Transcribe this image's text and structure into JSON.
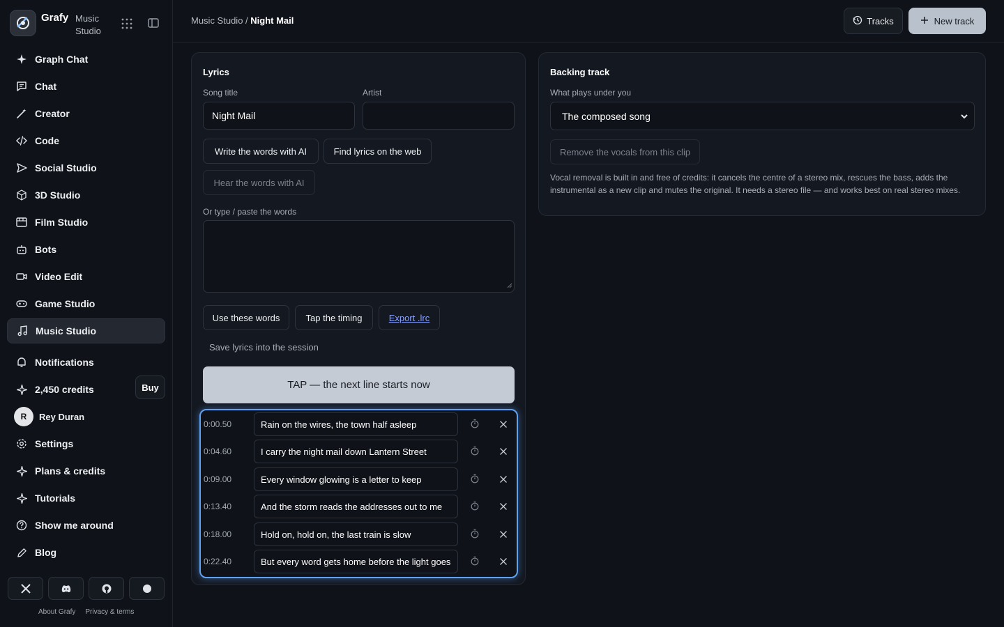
{
  "brand": {
    "name": "Grafy",
    "sub": "Music Studio"
  },
  "nav": [
    {
      "label": "Graph Chat",
      "icon": "sparkle-icon",
      "active": false
    },
    {
      "label": "Chat",
      "icon": "chat-icon",
      "active": false
    },
    {
      "label": "Creator",
      "icon": "magic-wand-icon",
      "active": false
    },
    {
      "label": "Code",
      "icon": "code-icon",
      "active": false
    },
    {
      "label": "Social Studio",
      "icon": "send-icon",
      "active": false
    },
    {
      "label": "3D Studio",
      "icon": "cube-icon",
      "active": false
    },
    {
      "label": "Film Studio",
      "icon": "film-icon",
      "active": false
    },
    {
      "label": "Bots",
      "icon": "bot-icon",
      "active": false
    },
    {
      "label": "Video Edit",
      "icon": "video-icon",
      "active": false
    },
    {
      "label": "Game Studio",
      "icon": "gamepad-icon",
      "active": false
    },
    {
      "label": "Music Studio",
      "icon": "music-icon",
      "active": true
    }
  ],
  "account": {
    "notifications": "Notifications",
    "credits": "2,450 credits",
    "buy": "Buy",
    "user_initial": "R",
    "user_name": "Rey Duran",
    "settings": "Settings",
    "plans": "Plans & credits",
    "tutorials": "Tutorials",
    "tour": "Show me around",
    "blog": "Blog"
  },
  "footer": {
    "about": "About Grafy",
    "privacy": "Privacy & terms"
  },
  "header": {
    "crumb_root": "Music Studio",
    "crumb_sep": " / ",
    "crumb_current": "Night Mail",
    "tracks_label": "Tracks",
    "new_track_label": "New track"
  },
  "lyrics": {
    "title": "Lyrics",
    "song_title_label": "Song title",
    "song_title_value": "Night Mail",
    "artist_label": "Artist",
    "artist_value": "",
    "write_ai": "Write the words with AI",
    "find_web": "Find lyrics on the web",
    "hear_ai": "Hear the words with AI",
    "paste_label": "Or type / paste the words",
    "use_words": "Use these words",
    "tap_timing": "Tap the timing",
    "export_lrc": "Export .lrc",
    "save_note": "Save lyrics into the session",
    "tap_button": "TAP — the next line starts now",
    "lines": [
      {
        "time": "0:00.50",
        "text": "Rain on the wires, the town half asleep"
      },
      {
        "time": "0:04.60",
        "text": "I carry the night mail down Lantern Street"
      },
      {
        "time": "0:09.00",
        "text": "Every window glowing is a letter to keep"
      },
      {
        "time": "0:13.40",
        "text": "And the storm reads the addresses out to me"
      },
      {
        "time": "0:18.00",
        "text": "Hold on, hold on, the last train is slow"
      },
      {
        "time": "0:22.40",
        "text": "But every word gets home before the light goes"
      }
    ]
  },
  "backing": {
    "title": "Backing track",
    "label": "What plays under you",
    "selected": "The composed song",
    "remove_vocals": "Remove the vocals from this clip",
    "description": "Vocal removal is built in and free of credits: it cancels the centre of a stereo mix, rescues the bass, adds the instrumental as a new clip and mutes the original. It needs a stereo file — and works best on real stereo mixes."
  },
  "colors": {
    "accent_glow": "#5fa2f2",
    "primary_button": "#b9c1cc",
    "link": "#8aa2ff"
  }
}
